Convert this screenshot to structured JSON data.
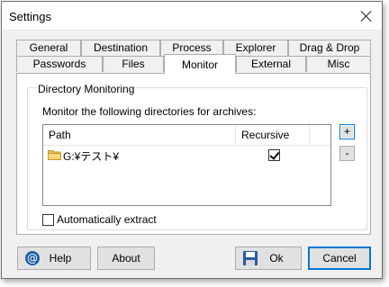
{
  "window": {
    "title": "Settings"
  },
  "tabs_row1": [
    "General",
    "Destination",
    "Process",
    "Explorer",
    "Drag & Drop"
  ],
  "tabs_row2": [
    "Passwords",
    "Files",
    "Monitor",
    "External",
    "Misc"
  ],
  "active_tab": "Monitor",
  "group": {
    "legend": "Directory Monitoring",
    "instruction": "Monitor the following directories for archives:",
    "columns": {
      "path": "Path",
      "recursive": "Recursive"
    },
    "rows": [
      {
        "path": "G:¥テスト¥",
        "recursive": true
      }
    ],
    "add_label": "+",
    "remove_label": "-",
    "auto_extract": {
      "label": "Automatically extract",
      "checked": false
    }
  },
  "buttons": {
    "help": "Help",
    "about": "About",
    "ok": "Ok",
    "cancel": "Cancel"
  },
  "colors": {
    "accent": "#0078d7",
    "window_bg": "#f0f0f0",
    "folder": "#f2c14e"
  }
}
